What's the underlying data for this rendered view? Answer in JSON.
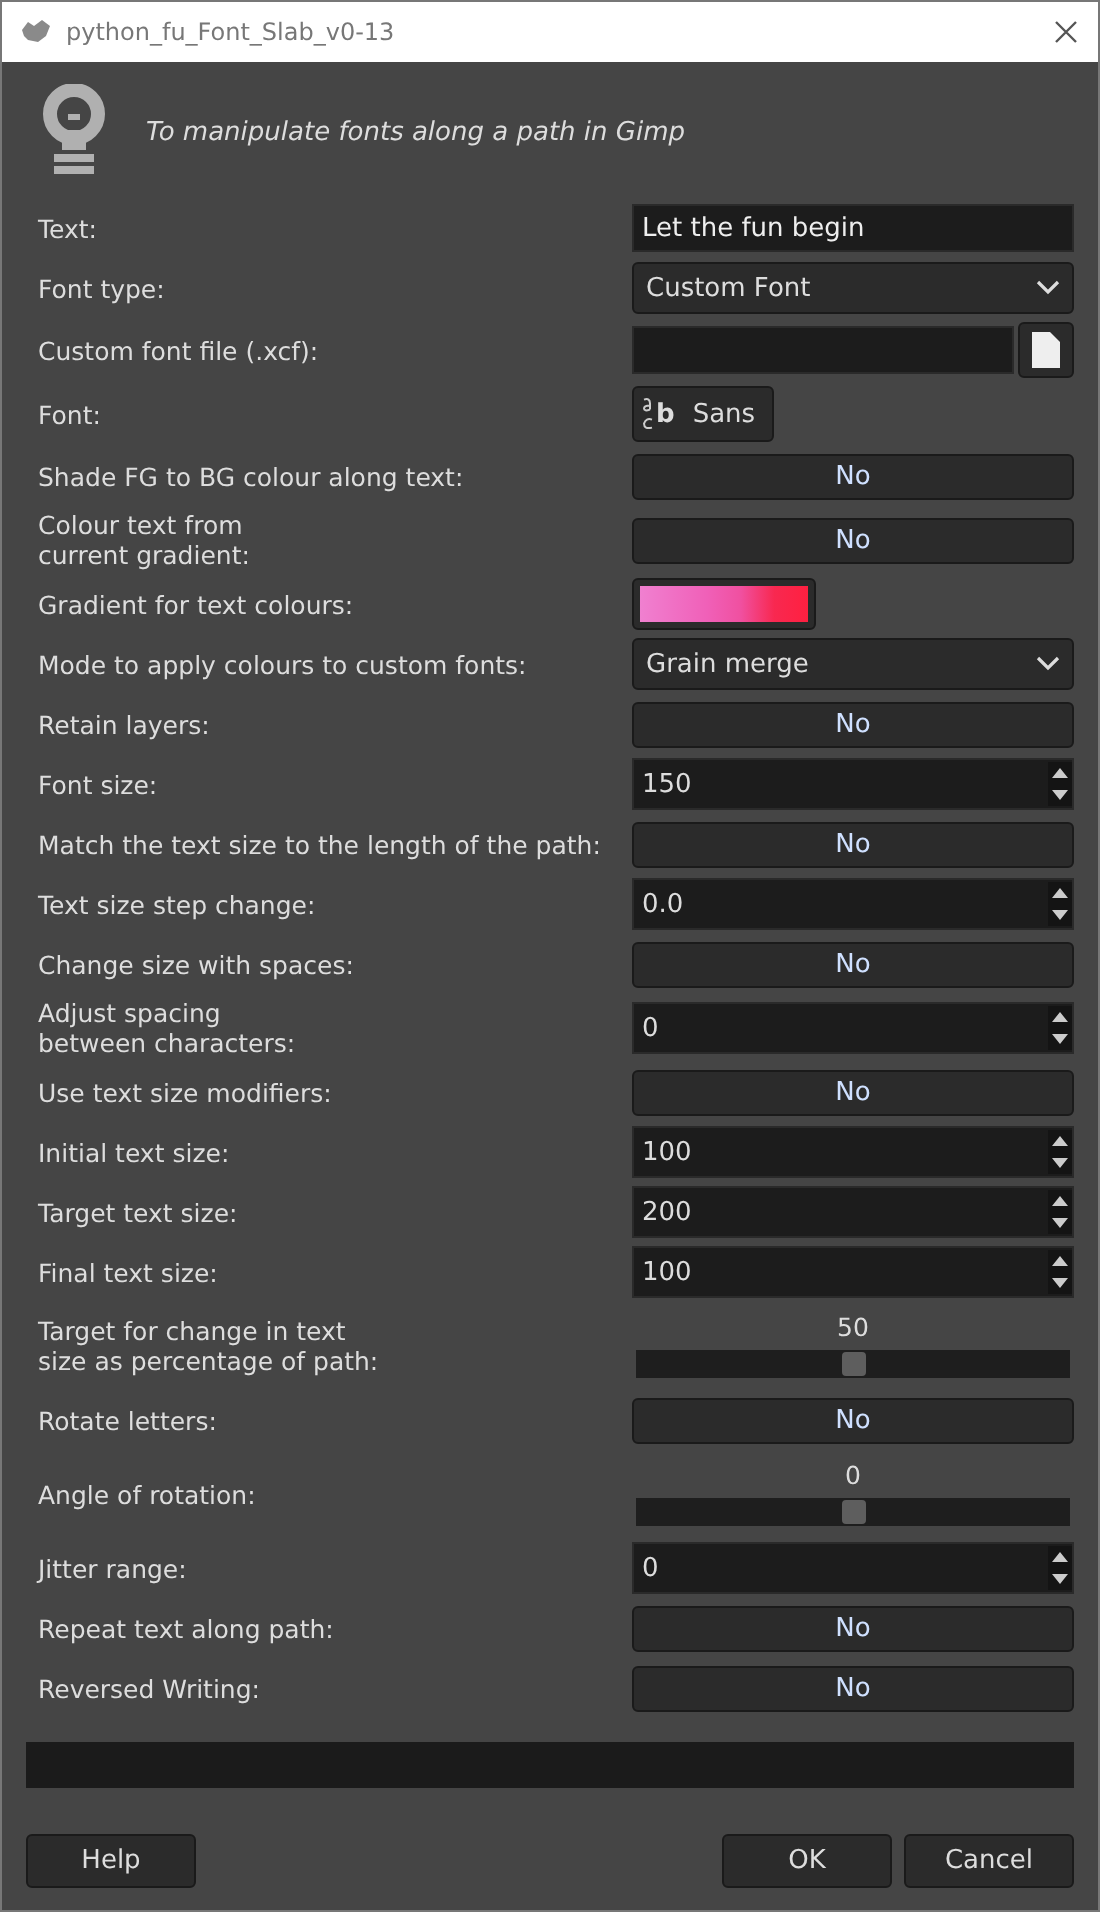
{
  "window": {
    "title": "python_fu_Font_Slab_v0-13"
  },
  "description": "To manipulate fonts along a path in Gimp",
  "fields": [
    {
      "kind": "entry",
      "label": "Text:",
      "value": "Let the fun begin"
    },
    {
      "kind": "combo",
      "label": "Font type:",
      "value": "Custom Font"
    },
    {
      "kind": "file",
      "label": "Custom font file (.xcf):"
    },
    {
      "kind": "font",
      "label": "Font:",
      "value": "Sans",
      "icon_text": "b"
    },
    {
      "kind": "toggle",
      "label": "Shade FG to BG colour along text:",
      "value": "No"
    },
    {
      "kind": "toggle",
      "label": "Colour text from\ncurrent gradient:",
      "value": "No"
    },
    {
      "kind": "gradient",
      "label": "Gradient for text colours:"
    },
    {
      "kind": "combo",
      "label": "Mode to apply colours to custom fonts:",
      "value": "Grain merge"
    },
    {
      "kind": "toggle",
      "label": "Retain layers:",
      "value": "No"
    },
    {
      "kind": "spin",
      "label": "Font size:",
      "value": "150"
    },
    {
      "kind": "toggle",
      "label": "Match the text size to the length of the path:",
      "value": "No"
    },
    {
      "kind": "spin",
      "label": "Text size step change:",
      "value": "0.0"
    },
    {
      "kind": "toggle",
      "label": "Change size with spaces:",
      "value": "No"
    },
    {
      "kind": "spin",
      "label": "Adjust spacing\nbetween characters:",
      "value": "0"
    },
    {
      "kind": "toggle",
      "label": "Use text size modifiers:",
      "value": "No"
    },
    {
      "kind": "spin",
      "label": "Initial text size:",
      "value": "100"
    },
    {
      "kind": "spin",
      "label": "Target text size:",
      "value": "200"
    },
    {
      "kind": "spin",
      "label": "Final text size:",
      "value": "100"
    },
    {
      "kind": "slider",
      "label": "Target for change in text\nsize as percentage of path:",
      "value": "50",
      "level": 0.5
    },
    {
      "kind": "toggle",
      "label": "Rotate letters:",
      "value": "No"
    },
    {
      "kind": "slider",
      "label": "Angle of rotation:",
      "value": "0",
      "level": 0.5
    },
    {
      "kind": "spin",
      "label": "Jitter range:",
      "value": "0"
    },
    {
      "kind": "toggle",
      "label": "Repeat text along path:",
      "value": "No"
    },
    {
      "kind": "toggle",
      "label": "Reversed Writing:",
      "value": "No"
    }
  ],
  "buttons": [
    {
      "label": "Help"
    },
    {
      "label": "OK"
    },
    {
      "label": "Cancel"
    }
  ]
}
